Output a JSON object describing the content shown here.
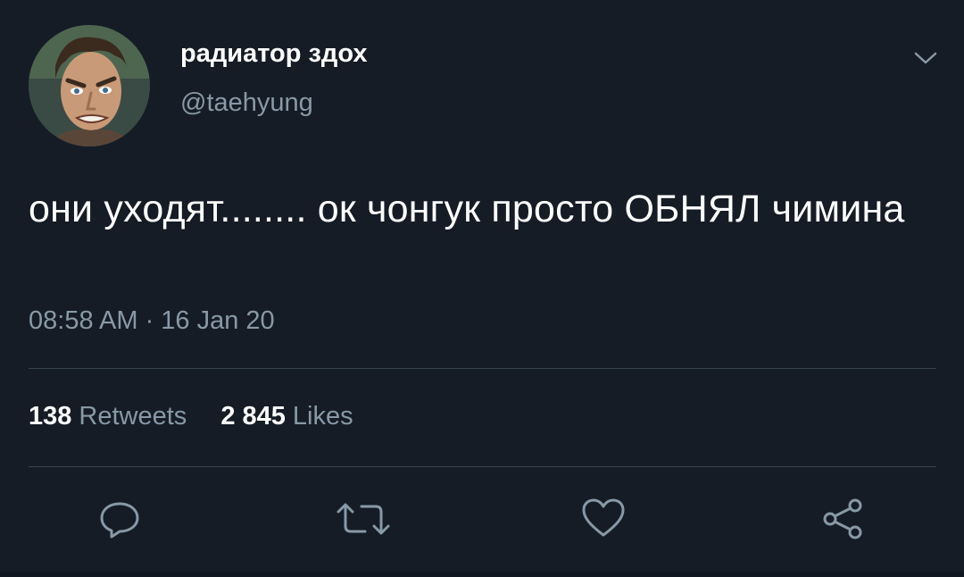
{
  "user": {
    "display_name": "радиатор здох",
    "handle": "@taehyung"
  },
  "tweet": {
    "text": "они уходят........ ок чонгук просто ОБНЯЛ чимина",
    "timestamp": "08:58 AM · 16 Jan 20"
  },
  "stats": {
    "retweets_count": "138",
    "retweets_label": "Retweets",
    "likes_count": "2 845",
    "likes_label": "Likes"
  },
  "icons": {
    "menu": "chevron-down-icon",
    "reply": "reply-icon",
    "retweet": "retweet-icon",
    "like": "heart-icon",
    "share": "share-icon"
  },
  "colors": {
    "background": "#151c26",
    "text_primary": "#ffffff",
    "text_secondary": "#8899a6",
    "divider": "#38444d"
  }
}
